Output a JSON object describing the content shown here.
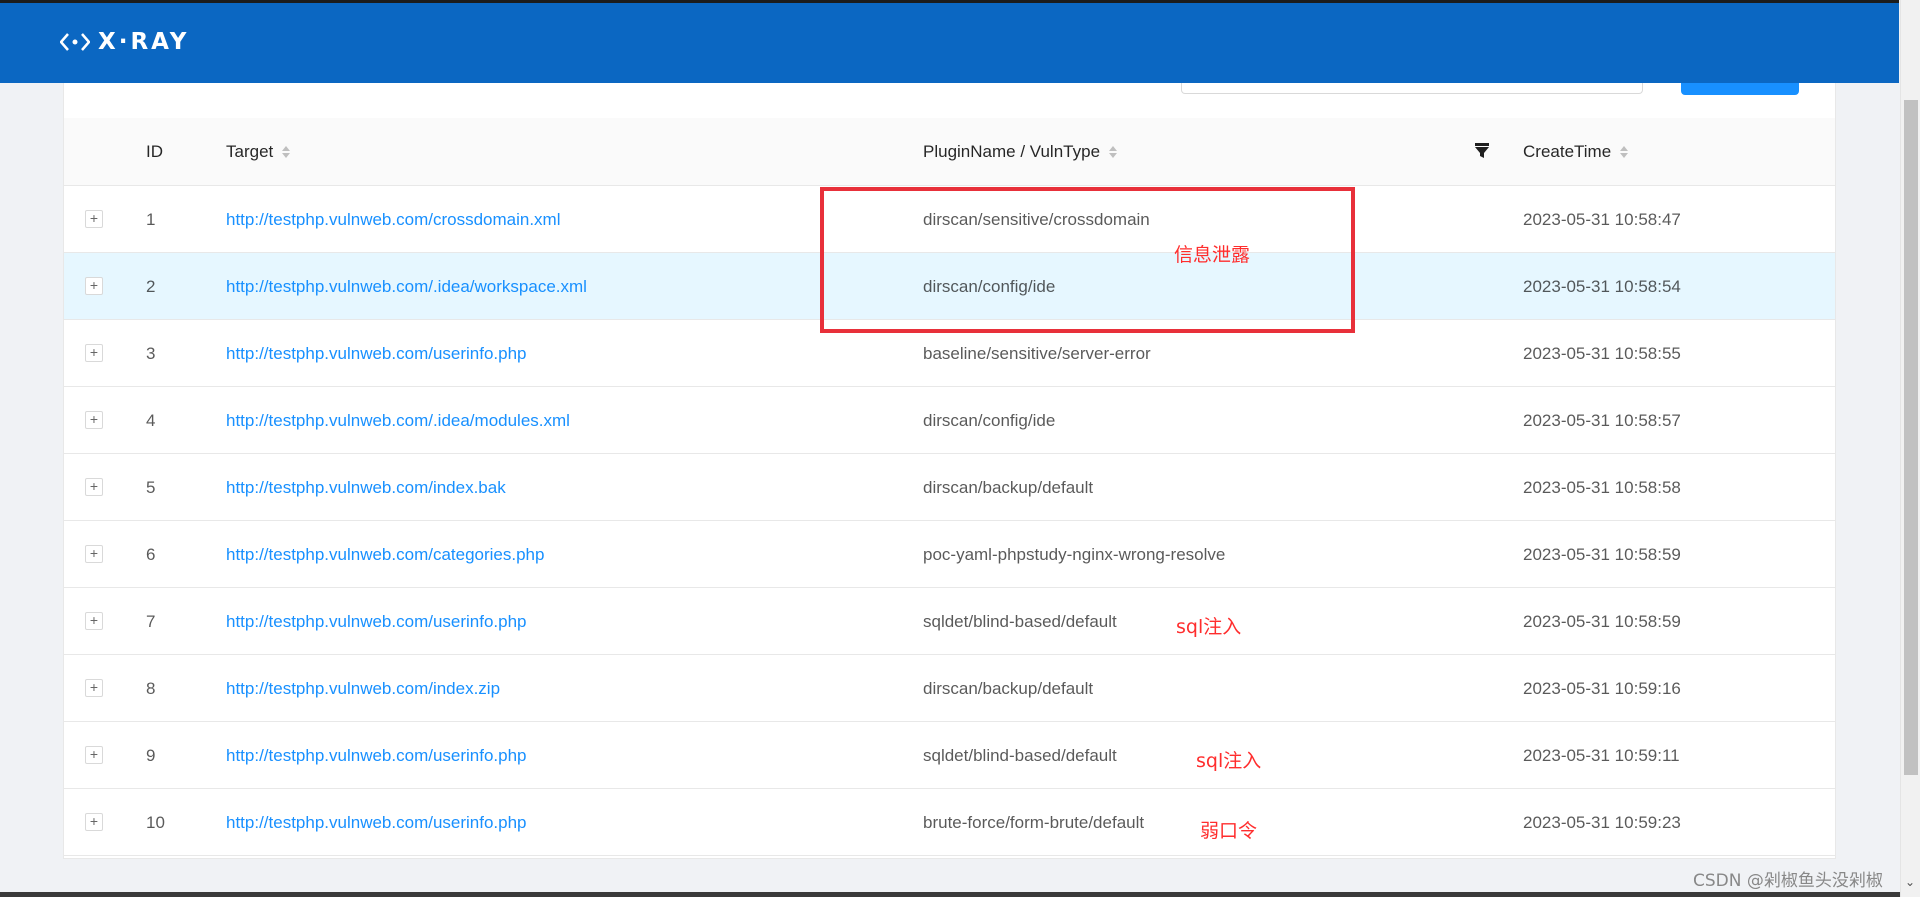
{
  "app": {
    "logo_text": "X·RAY"
  },
  "table": {
    "columns": {
      "id": "ID",
      "target": "Target",
      "plugin": "PluginName / VulnType",
      "create_time": "CreateTime"
    },
    "rows": [
      {
        "expand": "+",
        "id": "1",
        "target": "http://testphp.vulnweb.com/crossdomain.xml",
        "plugin": "dirscan/sensitive/crossdomain",
        "time": "2023-05-31 10:58:47"
      },
      {
        "expand": "+",
        "id": "2",
        "target": "http://testphp.vulnweb.com/.idea/workspace.xml",
        "plugin": "dirscan/config/ide",
        "time": "2023-05-31 10:58:54"
      },
      {
        "expand": "+",
        "id": "3",
        "target": "http://testphp.vulnweb.com/userinfo.php",
        "plugin": "baseline/sensitive/server-error",
        "time": "2023-05-31 10:58:55"
      },
      {
        "expand": "+",
        "id": "4",
        "target": "http://testphp.vulnweb.com/.idea/modules.xml",
        "plugin": "dirscan/config/ide",
        "time": "2023-05-31 10:58:57"
      },
      {
        "expand": "+",
        "id": "5",
        "target": "http://testphp.vulnweb.com/index.bak",
        "plugin": "dirscan/backup/default",
        "time": "2023-05-31 10:58:58"
      },
      {
        "expand": "+",
        "id": "6",
        "target": "http://testphp.vulnweb.com/categories.php",
        "plugin": "poc-yaml-phpstudy-nginx-wrong-resolve",
        "time": "2023-05-31 10:58:59"
      },
      {
        "expand": "+",
        "id": "7",
        "target": "http://testphp.vulnweb.com/userinfo.php",
        "plugin": "sqldet/blind-based/default",
        "time": "2023-05-31 10:58:59"
      },
      {
        "expand": "+",
        "id": "8",
        "target": "http://testphp.vulnweb.com/index.zip",
        "plugin": "dirscan/backup/default",
        "time": "2023-05-31 10:59:16"
      },
      {
        "expand": "+",
        "id": "9",
        "target": "http://testphp.vulnweb.com/userinfo.php",
        "plugin": "sqldet/blind-based/default",
        "time": "2023-05-31 10:59:11"
      },
      {
        "expand": "+",
        "id": "10",
        "target": "http://testphp.vulnweb.com/userinfo.php",
        "plugin": "brute-force/form-brute/default",
        "time": "2023-05-31 10:59:23"
      }
    ]
  },
  "annotations": {
    "info_leak": "信息泄露",
    "sql_injection_1": "sql注入",
    "sql_injection_2": "sql注入",
    "weak_password": "弱口令"
  },
  "watermark": "CSDN @剁椒鱼头没剁椒",
  "colors": {
    "header": "#0b67c2",
    "link": "#1890ff",
    "highlight_row": "#e6f7ff",
    "annotation": "#ff2d2d"
  }
}
